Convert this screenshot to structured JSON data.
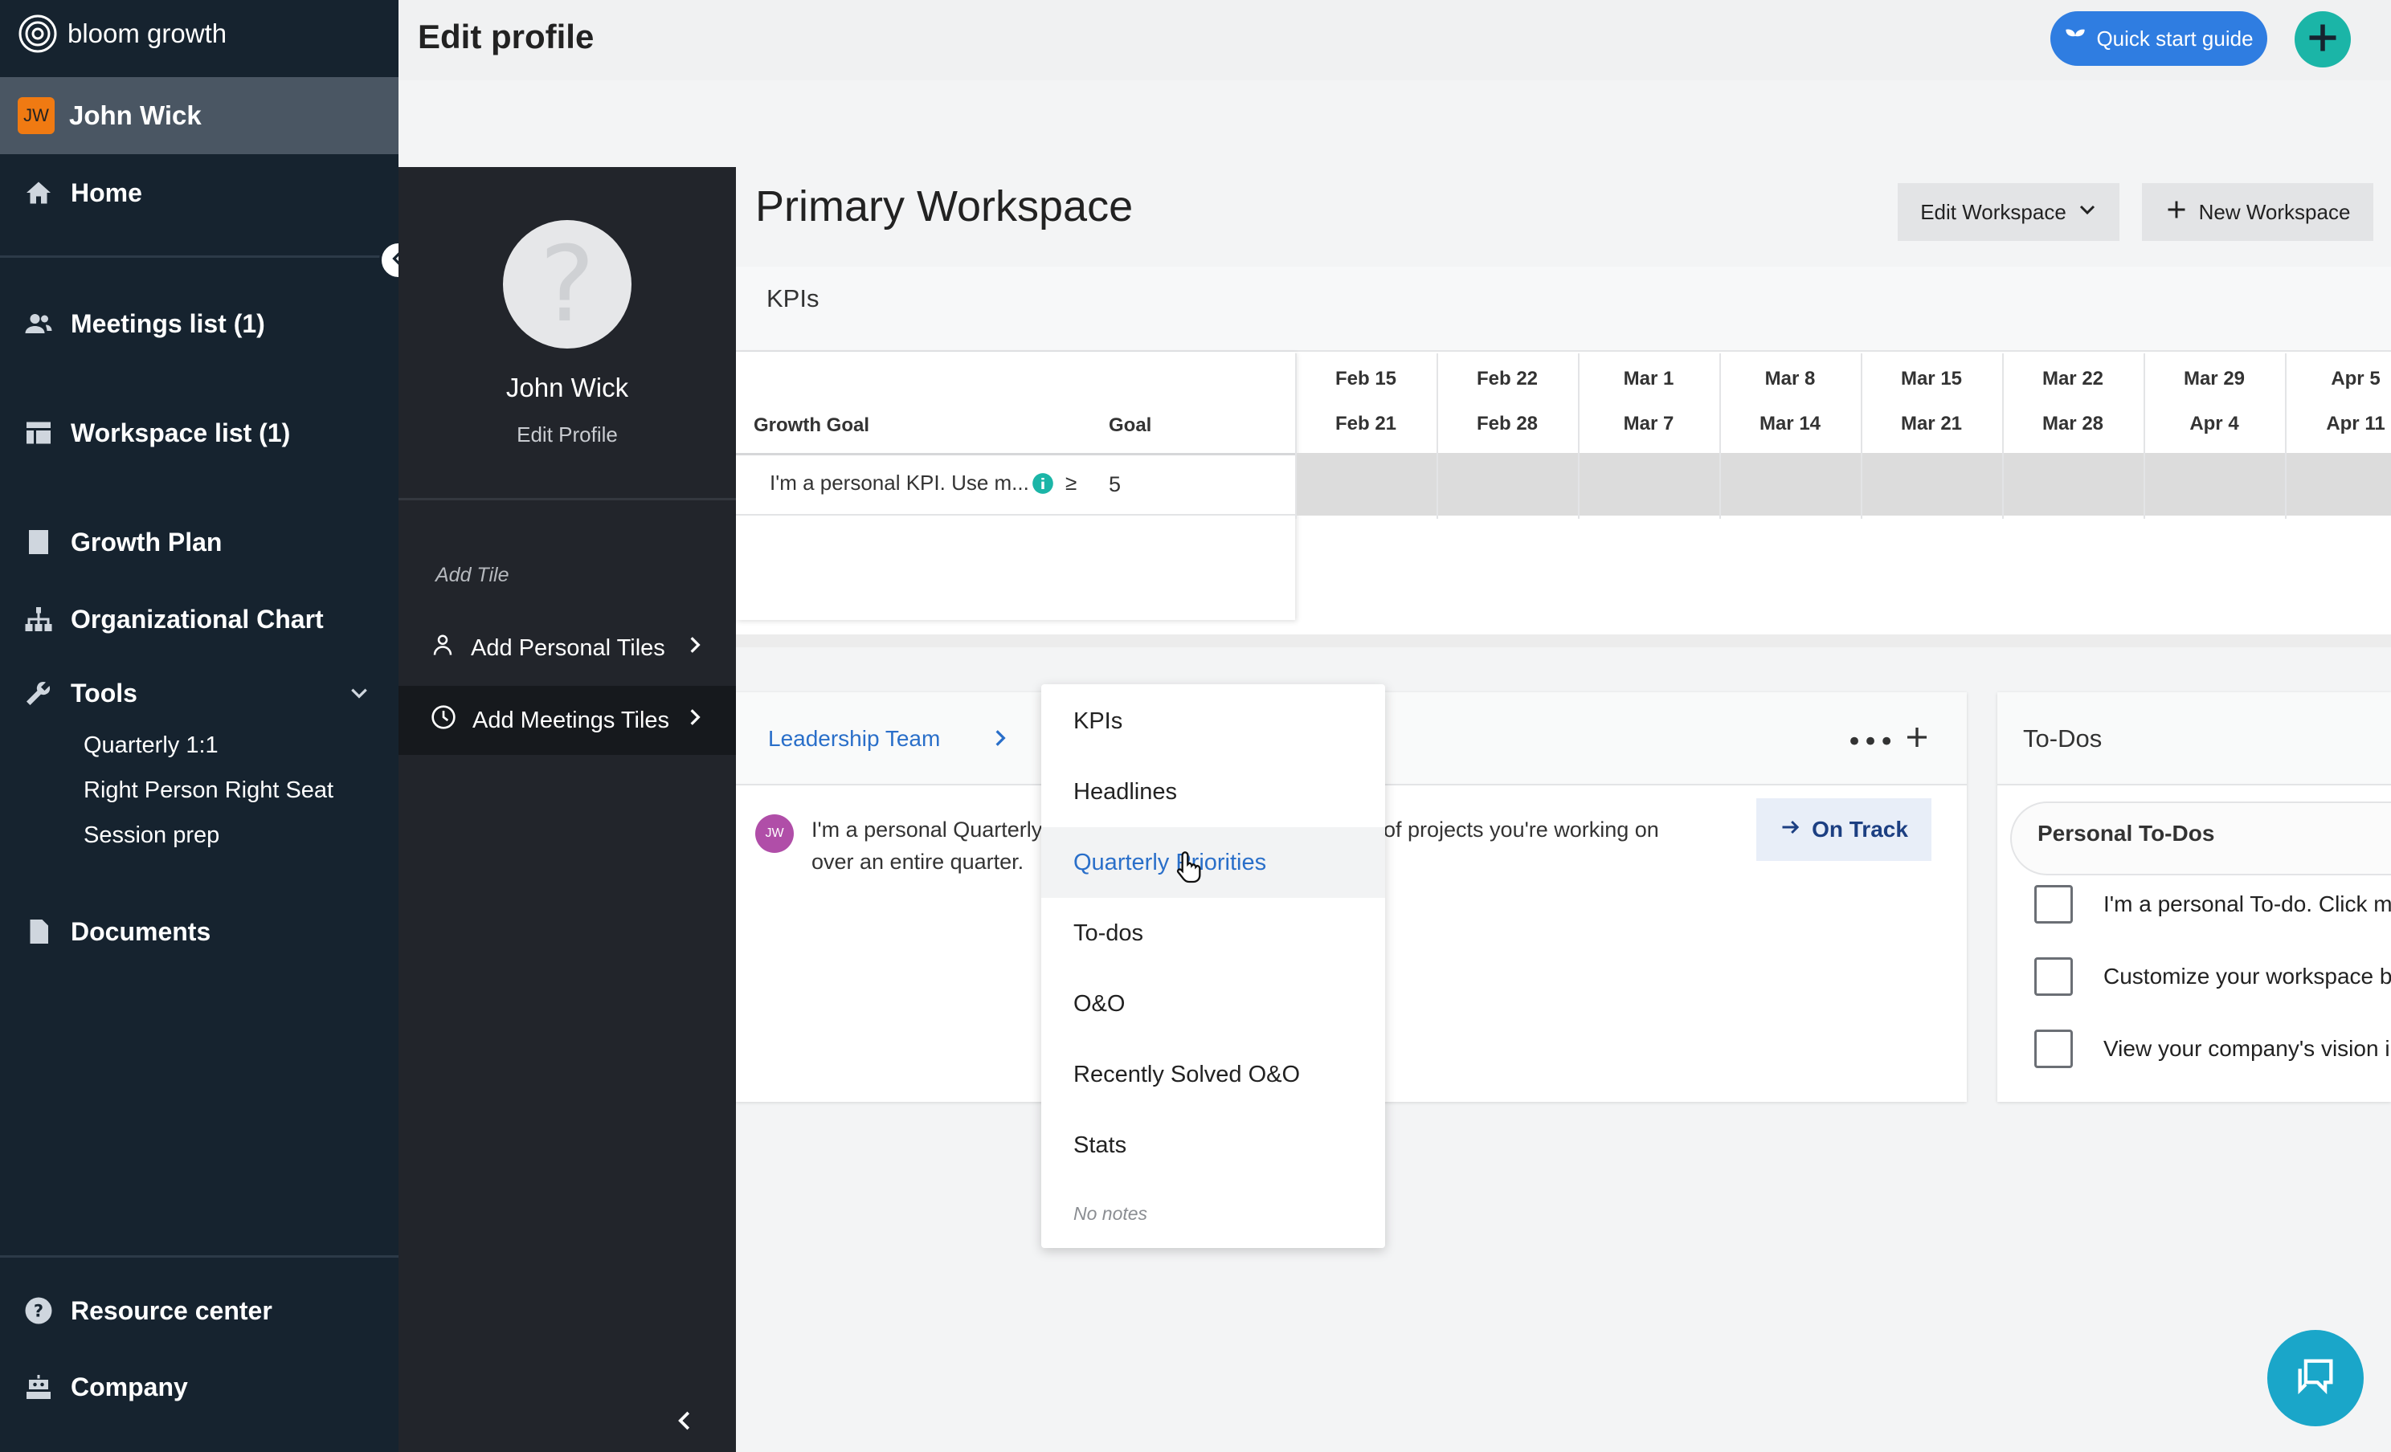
{
  "app": {
    "brand": "bloom growth",
    "page_title": "Edit profile"
  },
  "topbar": {
    "quick_start_label": "Quick start guide"
  },
  "user": {
    "initials": "JW",
    "name": "John Wick"
  },
  "nav": {
    "home": "Home",
    "meetings": "Meetings list (1)",
    "workspaces": "Workspace list (1)",
    "growth_plan": "Growth Plan",
    "org_chart": "Organizational Chart",
    "tools": "Tools",
    "tools_items": [
      "Quarterly 1:1",
      "Right Person Right Seat",
      "Session prep"
    ],
    "documents": "Documents",
    "resource_center": "Resource center",
    "company": "Company"
  },
  "panel": {
    "name": "John Wick",
    "edit_profile": "Edit Profile",
    "add_tile": "Add Tile",
    "add_personal_tiles": "Add Personal Tiles",
    "add_meetings_tiles": "Add Meetings Tiles"
  },
  "workspace": {
    "title": "Primary Workspace",
    "edit_button": "Edit Workspace",
    "new_button": "New Workspace"
  },
  "kpis": {
    "title": "KPIs",
    "col_goal_name": "Growth Goal",
    "col_goal": "Goal",
    "row_name": "I'm a personal KPI. Use m...",
    "row_operator": "≥",
    "row_goal": "5",
    "weeks": [
      {
        "start": "Feb 15",
        "end": "Feb 21"
      },
      {
        "start": "Feb 22",
        "end": "Feb 28"
      },
      {
        "start": "Mar 1",
        "end": "Mar 7"
      },
      {
        "start": "Mar 8",
        "end": "Mar 14"
      },
      {
        "start": "Mar 15",
        "end": "Mar 21"
      },
      {
        "start": "Mar 22",
        "end": "Mar 28"
      },
      {
        "start": "Mar 29",
        "end": "Apr 4"
      },
      {
        "start": "Apr 5",
        "end": "Apr 11"
      }
    ]
  },
  "priorities": {
    "leadership_team": "Leadership Team",
    "row_avatar": "JW",
    "row_text_1a": "I'm a personal Quarterly",
    "row_text_1b": "of projects you're working on",
    "row_text_2": "over an entire quarter.",
    "status": "On Track"
  },
  "dropdown": {
    "items": [
      "KPIs",
      "Headlines",
      "Quarterly Priorities",
      "To-dos",
      "O&O",
      "Recently Solved O&O",
      "Stats"
    ],
    "highlighted": "Quarterly Priorities",
    "footer": "No notes"
  },
  "todos": {
    "title": "To-Dos",
    "section": "Personal To-Dos",
    "items": [
      "I'm a personal To-do. Click me",
      "Customize your workspace b",
      "View your company's vision i"
    ]
  },
  "colors": {
    "nav_bg": "#16232f",
    "panel_bg": "#22252b",
    "accent_blue": "#2f7de1",
    "accent_teal": "#1bb5a7",
    "link": "#2a6fc9"
  }
}
